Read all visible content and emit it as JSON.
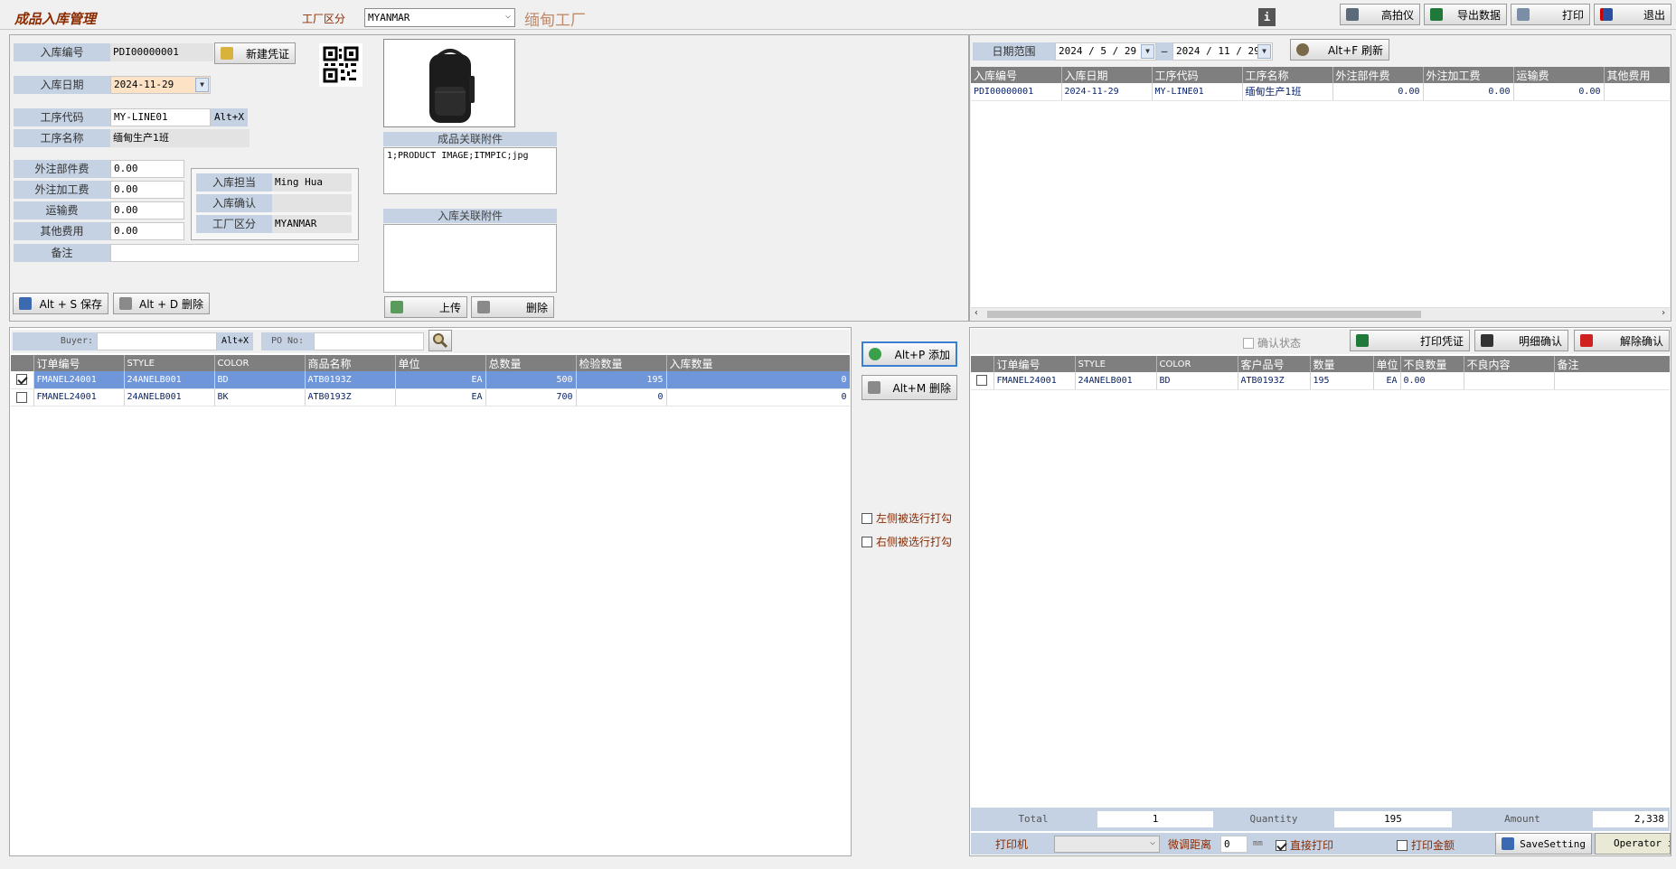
{
  "header": {
    "title": "成品入库管理",
    "factory_label": "工厂区分",
    "factory_value": "MYANMAR",
    "factory_name": "缅甸工厂",
    "info_btn": "i",
    "buttons": {
      "camera": "高拍仪",
      "export": "导出数据",
      "print": "打印",
      "exit": "退出"
    }
  },
  "form": {
    "receipt_no_label": "入库编号",
    "receipt_no": "PDI00000001",
    "new_voucher": "新建凭证",
    "date_label": "入库日期",
    "date": "2024-11-29",
    "proc_code_label": "工序代码",
    "proc_code": "MY-LINE01",
    "proc_code_btn": "Alt+X",
    "proc_name_label": "工序名称",
    "proc_name": "缅甸生产1班",
    "fees": [
      {
        "label": "外注部件费",
        "value": "0.00"
      },
      {
        "label": "外注加工费",
        "value": "0.00"
      },
      {
        "label": "运输费",
        "value": "0.00"
      },
      {
        "label": "其他费用",
        "value": "0.00"
      }
    ],
    "in_charge_label": "入库担当",
    "in_charge": "Ming Hua",
    "confirm_label": "入库确认",
    "confirm": "",
    "factory_label": "工厂区分",
    "factory": "MYANMAR",
    "remark_label": "备注",
    "remark": "",
    "save_btn": "Alt + S 保存",
    "delete_btn": "Alt + D 删除"
  },
  "attachments": {
    "product_header": "成品关联附件",
    "product_content": "1;PRODUCT IMAGE;ITMPIC;jpg",
    "receipt_header": "入库关联附件",
    "receipt_content": "",
    "upload_btn": "上传",
    "delete_btn": "删除"
  },
  "list_panel": {
    "date_range_label": "日期范围",
    "date_from": "2024 / 5 / 29",
    "date_to": "2024 / 11 / 29",
    "refresh_btn": "Alt+F 刷新",
    "columns": [
      "入库编号",
      "入库日期",
      "工序代码",
      "工序名称",
      "外注部件费",
      "外注加工费",
      "运输费",
      "其他费用"
    ],
    "rows": [
      [
        "PDI00000001",
        "2024-11-29",
        "MY-LINE01",
        "缅甸生产1班",
        "0.00",
        "0.00",
        "0.00",
        ""
      ]
    ]
  },
  "order_panel": {
    "buyer_label": "Buyer:",
    "buyer_value": "",
    "alt_x": "Alt+X",
    "po_label": "PO No:",
    "po_value": "",
    "columns": [
      "订单编号",
      "STYLE",
      "COLOR",
      "商品名称",
      "单位",
      "总数量",
      "检验数量",
      "入库数量"
    ],
    "rows": [
      {
        "checked": true,
        "selected": true,
        "cells": [
          "FMANEL24001",
          "24ANELB001",
          "BD",
          "ATB0193Z",
          "EA",
          "500",
          "195",
          "0"
        ]
      },
      {
        "checked": false,
        "selected": false,
        "cells": [
          "FMANEL24001",
          "24ANELB001",
          "BK",
          "ATB0193Z",
          "EA",
          "700",
          "0",
          "0"
        ]
      }
    ]
  },
  "middle": {
    "add_btn": "Alt+P 添加",
    "remove_btn": "Alt+M 删除",
    "left_select": "左侧被选行打勾",
    "right_select": "右侧被选行打勾"
  },
  "detail_panel": {
    "confirm_state": "确认状态",
    "print_voucher": "打印凭证",
    "detail_confirm": "明细确认",
    "cancel_confirm": "解除确认",
    "columns": [
      "订单编号",
      "STYLE",
      "COLOR",
      "客户品号",
      "数量",
      "单位",
      "不良数量",
      "不良内容",
      "备注"
    ],
    "rows": [
      {
        "checked": false,
        "cells": [
          "FMANEL24001",
          "24ANELB001",
          "BD",
          "ATB0193Z",
          "195",
          "EA",
          "0.00",
          "",
          ""
        ]
      }
    ],
    "total_label": "Total",
    "total": "1",
    "quantity_label": "Quantity",
    "quantity": "195",
    "amount_label": "Amount",
    "amount": "2,338"
  },
  "footer": {
    "printer_label": "打印机",
    "printer_value": "",
    "offset_label": "微调距离",
    "offset_value": "0",
    "offset_unit": "mm",
    "direct_print": "直接打印",
    "print_amount": "打印金额",
    "save_setting": "SaveSetting",
    "operator": "Operator i"
  },
  "colors": {
    "accent": "#c5d2e3",
    "title": "#8b2b00",
    "grid_header": "#7f7f7f",
    "selected_row": "#6f96d8"
  }
}
